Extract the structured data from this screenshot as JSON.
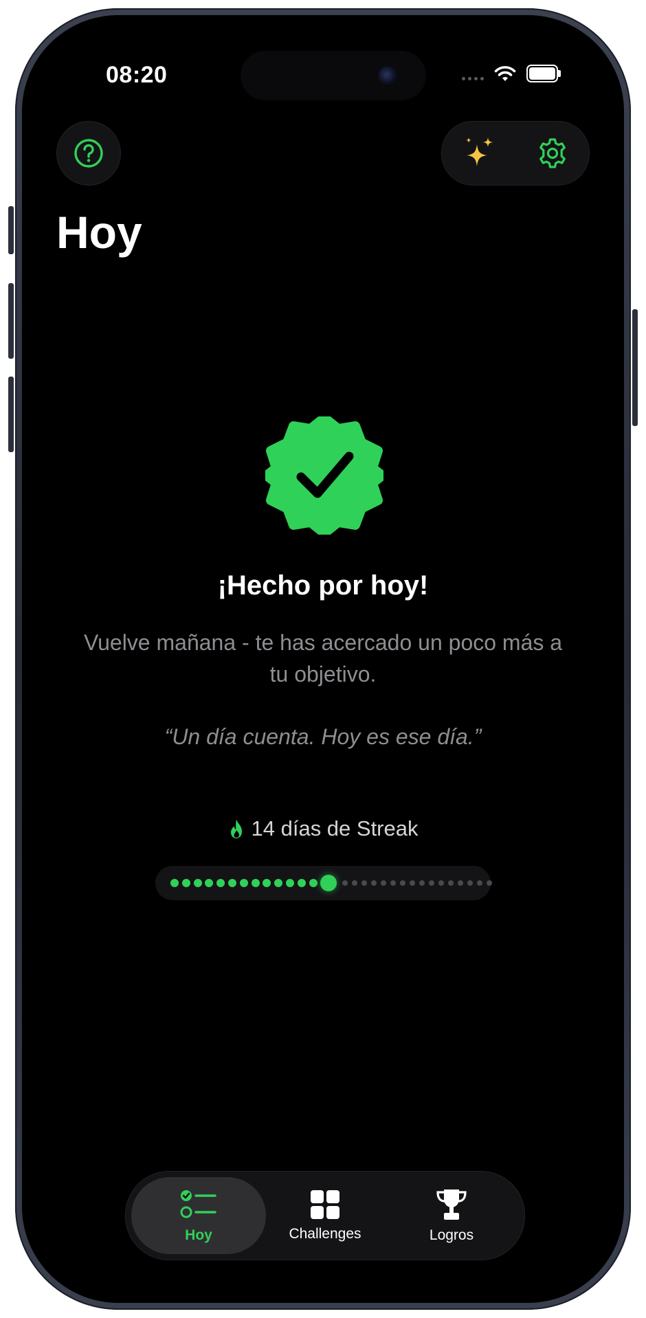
{
  "status_bar": {
    "time": "08:20"
  },
  "toolbar": {
    "help_icon": "question-circle-icon",
    "sparkles_icon": "sparkles-icon",
    "settings_icon": "gear-icon"
  },
  "page": {
    "title": "Hoy"
  },
  "completion": {
    "badge_icon": "checkmark-seal-icon",
    "title": "¡Hecho por hoy!",
    "subtitle": "Vuelve mañana - te has acercado un poco más a tu objetivo.",
    "quote": "“Un día cuenta. Hoy es ese día.”"
  },
  "streak": {
    "icon": "flame-icon",
    "label": "14 días de Streak",
    "days_completed": 14,
    "days_remaining_shown": 16
  },
  "tabs": [
    {
      "label": "Hoy",
      "icon": "checklist-icon",
      "active": true
    },
    {
      "label": "Challenges",
      "icon": "grid-icon",
      "active": false
    },
    {
      "label": "Logros",
      "icon": "trophy-icon",
      "active": false
    }
  ],
  "colors": {
    "accent_green": "#30d158",
    "sparkle_yellow": "#f5c542",
    "background": "#000000",
    "secondary_text": "#8e8e93"
  }
}
